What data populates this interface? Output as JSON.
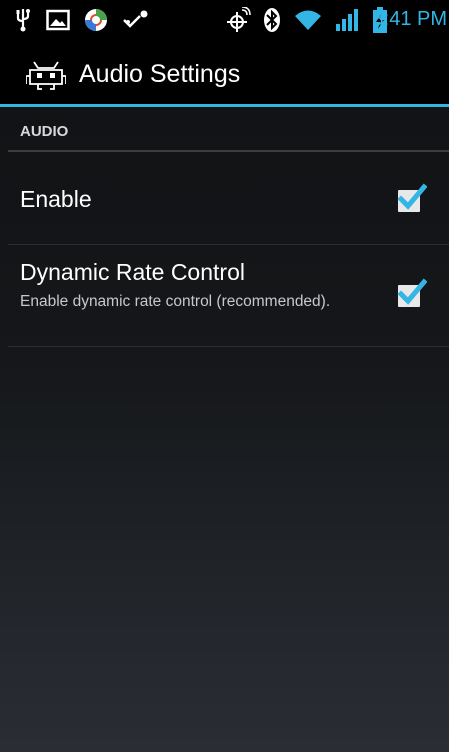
{
  "status_bar": {
    "time": "3:41 PM",
    "left_icons": [
      "usb-icon",
      "image-icon",
      "app-icon",
      "signal-path-icon"
    ],
    "right_icons": [
      "gps-icon",
      "bluetooth-icon",
      "wifi-icon",
      "cell-signal-icon",
      "battery-charging-icon"
    ]
  },
  "action_bar": {
    "title": "Audio Settings",
    "app_icon": "retroarch-invader-icon",
    "accent_color": "#33b5e5"
  },
  "category": {
    "title": "AUDIO"
  },
  "preferences": [
    {
      "title": "Enable",
      "summary": "",
      "checked": true
    },
    {
      "title": "Dynamic Rate Control",
      "summary": "Enable dynamic rate control (recommended).",
      "checked": true
    }
  ],
  "colors": {
    "accent": "#33b5e5",
    "background": "#15171a"
  }
}
